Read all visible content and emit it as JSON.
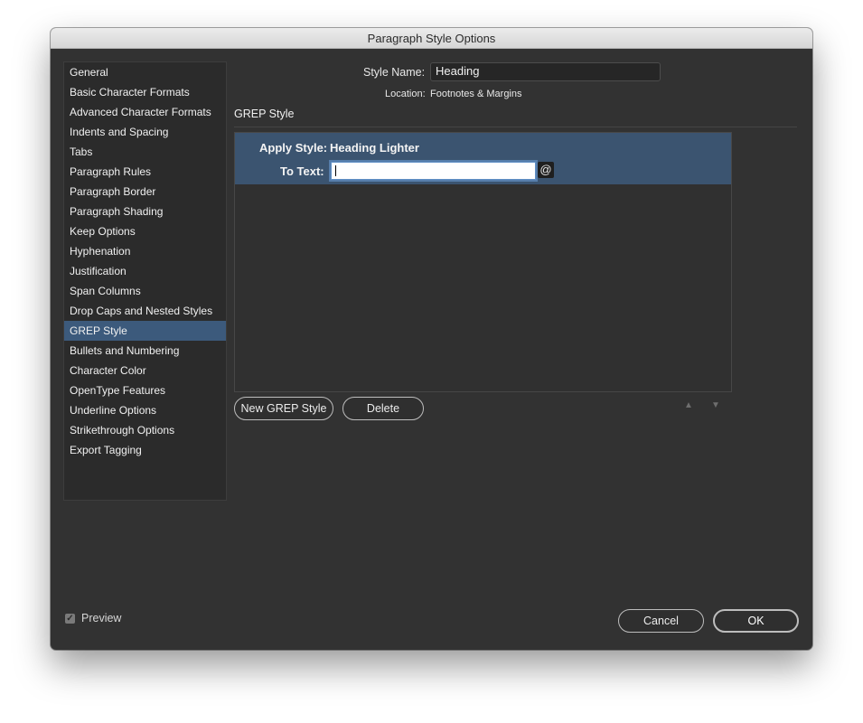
{
  "window": {
    "title": "Paragraph Style Options"
  },
  "sidebar": {
    "items": [
      "General",
      "Basic Character Formats",
      "Advanced Character Formats",
      "Indents and Spacing",
      "Tabs",
      "Paragraph Rules",
      "Paragraph Border",
      "Paragraph Shading",
      "Keep Options",
      "Hyphenation",
      "Justification",
      "Span Columns",
      "Drop Caps and Nested Styles",
      "GREP Style",
      "Bullets and Numbering",
      "Character Color",
      "OpenType Features",
      "Underline Options",
      "Strikethrough Options",
      "Export Tagging"
    ],
    "selected": "GREP Style"
  },
  "header": {
    "style_name_label": "Style Name:",
    "style_name_value": "Heading",
    "location_label": "Location:",
    "location_value": "Footnotes & Margins"
  },
  "section": {
    "title": "GREP Style"
  },
  "grep_rule": {
    "apply_style_label": "Apply Style:",
    "apply_style_value": "Heading Lighter",
    "to_text_label": "To Text:",
    "to_text_value": "",
    "special_chars_icon": "at-sign-icon",
    "special_chars_glyph": "@"
  },
  "buttons": {
    "new_grep_style": "New GREP Style",
    "delete": "Delete",
    "move_up_icon": "triangle-up-icon",
    "move_down_icon": "triangle-down-icon",
    "cancel": "Cancel",
    "ok": "OK"
  },
  "preview": {
    "label": "Preview",
    "checked": true
  },
  "colors": {
    "dialog_bg": "#323232",
    "selection_bg": "#3c5a7c",
    "rule_row_bg": "#3b5470"
  }
}
